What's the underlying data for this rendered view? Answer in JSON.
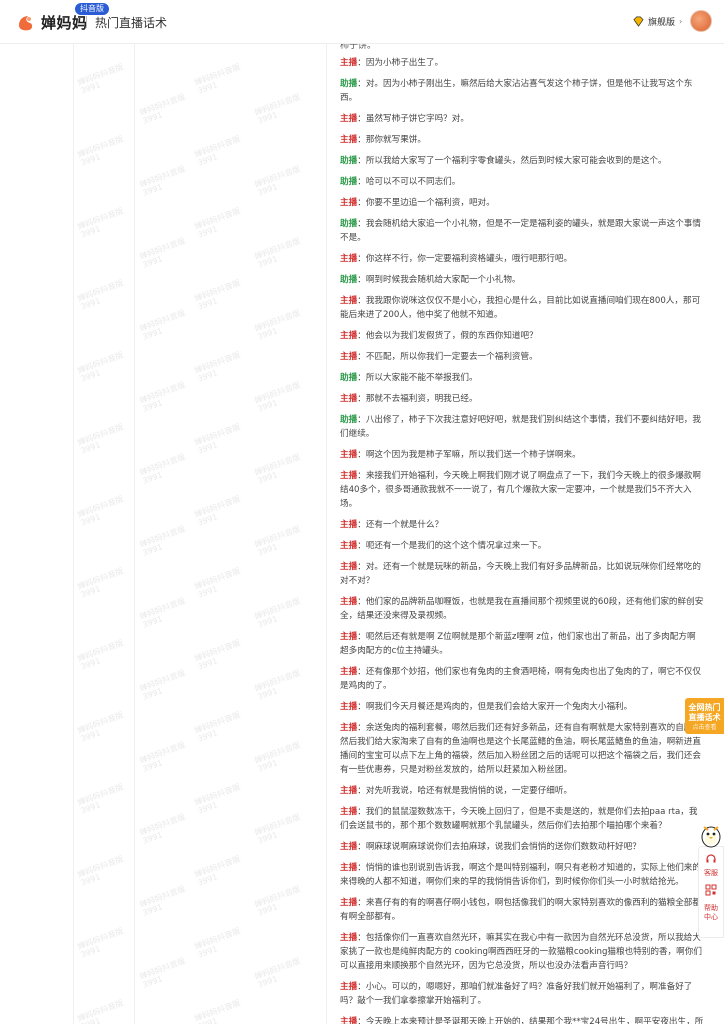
{
  "header": {
    "logo_text": "婵妈妈",
    "logo_badge": "抖音版",
    "page_title": "热门直播话术",
    "vip_label": "旗舰版",
    "vip_arrow": "›"
  },
  "watermark_text": "婵妈妈抖音版\n3991",
  "content_top_text": "柿子饼。",
  "speakers": {
    "host": "主播",
    "assistant": "助播"
  },
  "lines": [
    {
      "speaker": "host",
      "text": "因为小柿子出生了。"
    },
    {
      "speaker": "assistant",
      "text": "对。因为小柿子刚出生，嘛然后给大家沾沾喜气发这个柿子饼，但是他不让我写这个东西。"
    },
    {
      "speaker": "host",
      "text": "虽然写柿子饼它字吗？对。"
    },
    {
      "speaker": "host",
      "text": "那你就写果饼。"
    },
    {
      "speaker": "assistant",
      "text": "所以我给大家写了一个福利字零食罐头，然后到时候大家可能会收到的是这个。"
    },
    {
      "speaker": "assistant",
      "text": "哈可以不可以不同志们。"
    },
    {
      "speaker": "host",
      "text": "你要不里边追一个福利资，吧对。"
    },
    {
      "speaker": "assistant",
      "text": "我会随机给大家追一个小礼物，但是不一定是福利姿的罐头，就是跟大家说一声这个事情不是。"
    },
    {
      "speaker": "host",
      "text": "你这样不行，你一定要福利资格罐头，哦行吧那行吧。"
    },
    {
      "speaker": "assistant",
      "text": "啊到时候我会随机给大家配一个小礼物。"
    },
    {
      "speaker": "host",
      "text": "我我跟你说咪这仅仅不是小心，我担心是什么，目前比如说直播间咱们现在800人，那可能后来进了200人，他中奖了他就不知道。"
    },
    {
      "speaker": "host",
      "text": "他会以为我们发假货了，假的东西你知道吧？"
    },
    {
      "speaker": "host",
      "text": "不匹配，所以你我们一定要去一个福利资管。"
    },
    {
      "speaker": "assistant",
      "text": "所以大家能不能不举报我们。"
    },
    {
      "speaker": "host",
      "text": "那就不去福利资，明我已经。"
    },
    {
      "speaker": "assistant",
      "text": "八出修了，柿子下次我注意好吧好吧，就是我们别纠结这个事情，我们不要纠结好吧，我们继续。"
    },
    {
      "speaker": "host",
      "text": "啊这个因为我是柿子军嘛，所以我们送一个柿子饼啊来。"
    },
    {
      "speaker": "host",
      "text": "来接我们开始福利，今天晚上啊我们刚才说了啊盘点了一下，我们今天晚上的很多爆款啊结40多个，很多哥通款我就不一一说了，有几个爆款大家一定要冲，一个就是我们5不齐大入场。"
    },
    {
      "speaker": "host",
      "text": "还有一个就是什么？"
    },
    {
      "speaker": "host",
      "text": "呃还有一个是我们的这个这个情况拿过来一下。"
    },
    {
      "speaker": "host",
      "text": "对。还有一个就是玩咪的新品，今天晚上我们有好多品牌新品，比如说玩咪你们经常吃的对不对？"
    },
    {
      "speaker": "host",
      "text": "他们家的品牌新品咖喱饭，也就是我在直播间那个视频里说的60段，还有他们家的鲜创安全，结果还没来得及录视频。"
    },
    {
      "speaker": "host",
      "text": "呃然后还有就是啊 Z位啊就是那个新蓝z哩啊 z位，他们家也出了新品，出了多肉配方啊超多肉配方的c位主持罐头。"
    },
    {
      "speaker": "host",
      "text": "还有像那个妙招，他们家也有兔肉的主食酒吧椅，啊有兔肉也出了兔肉的了，啊它不仅仅是鸡肉的了。"
    },
    {
      "speaker": "host",
      "text": "啊我们今天月餐还是鸡肉的，但是我们会给大家开一个兔肉大小福利。"
    },
    {
      "speaker": "host",
      "text": "余送兔肉的福利套餐，嗯然后我们还有好多新品，还有自有啊就是大家特别喜欢的自牌，然后我们给大家淘来了自有的鱼油啊也是这个长尾蓝鳍的鱼油，啊长尾蓝鳍鱼的鱼油，啊新进直播间的宝宝可以点下左上角的福袋，然后加入粉丝团之后的话呢可以把这个福袋之后，我们还会有一些优惠券，只是对粉丝发放的，给所以赶紧加入粉丝团。"
    },
    {
      "speaker": "host",
      "text": "对先听我说，哈还有就是我悄悄的说，一定要仔细听。"
    },
    {
      "speaker": "host",
      "text": "我们的鼠鼠湿数数冻干，今天晚上回归了，但是不卖是送的，就是你们去拍paa rta，我们会送鼠书的，那个那个数数罐啊就那个乳鼠罐头，然后你们去拍那个喵拍哪个来着？"
    },
    {
      "speaker": "host",
      "text": "啊麻球说啊麻球说你们去拍麻球，说我们会悄悄的送你们数数动杆好吧？"
    },
    {
      "speaker": "host",
      "text": "悄悄的谁也别说别告诉我，啊这个是叫特别福利，啊只有老粉才知道的，实际上他们来的来得晚的人都不知道，啊你们来的早的我悄悄告诉你们，到时候你你们头一小时就给抢光。"
    },
    {
      "speaker": "host",
      "text": "来喜仔有的有的啊喜仔啊小钱包，啊包括像我们的啊大家特别喜欢的像西利的猫粮全部都有啊全部都有。"
    },
    {
      "speaker": "host",
      "text": "包括像你们一直喜欢自然光环，嘛其实在我心中有一款因为自然光环总没货，所以我给大家挑了一款也是纯鲜肉配方的 cooking啊西西旺牙的一款猫粮cooking猫粮也特别的香，啊你们可以直接用来顺换那个自然光环，因为它总没货，所以也没办法看声音行吗？"
    },
    {
      "speaker": "host",
      "text": "小心。可以的，嗯嗯好，那咱们就准备好了吗？准备好我们就开始福利了，啊准备好了吗？敲个一我们拿拳擦掌开始福利了。"
    },
    {
      "speaker": "host",
      "text": "今天晚上本来预计是圣诞那天晚上开始的，结果那个我**宝24号出生，啊平安夜出生，所以就圣诞那天的直播就推到了今天晚上，但是福利不变福利不变，来吧。"
    }
  ],
  "promo": {
    "line1": "全网热门",
    "line2": "直播话术",
    "sub": "点击查看"
  },
  "sidebar": {
    "item1": "客服",
    "item2_label": "",
    "item3": "帮助中心"
  },
  "colors": {
    "host": "#d0302f",
    "assistant": "#2a9a48",
    "brand": "#f06a3a",
    "promo": "#f5a623"
  },
  "icons": [
    "logo-icon",
    "diamond-icon",
    "avatar",
    "mascot-icon",
    "headset-icon",
    "qr-icon",
    "help-icon"
  ]
}
